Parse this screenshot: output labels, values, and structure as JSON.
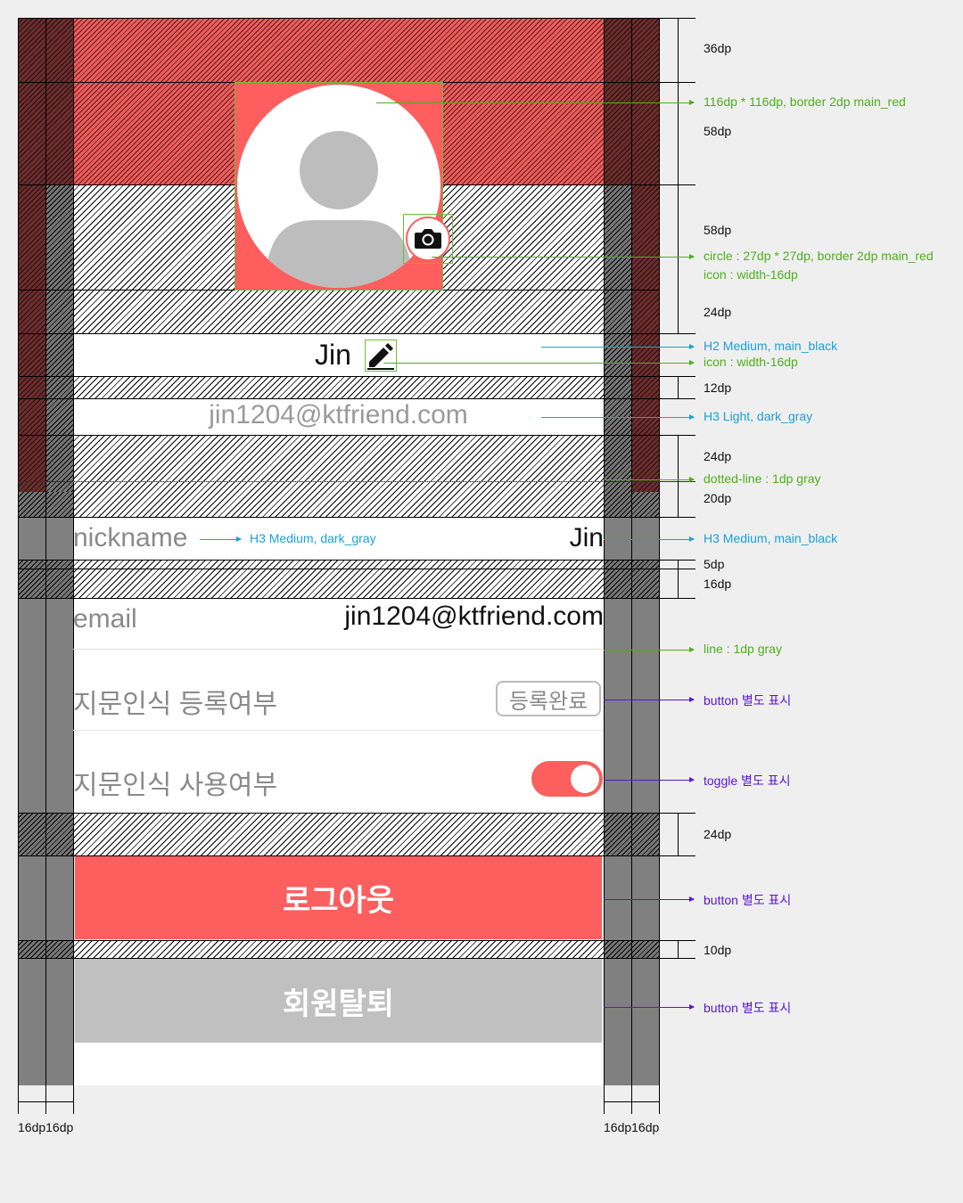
{
  "profile": {
    "name": "Jin",
    "email": "jin1204@ktfriend.com"
  },
  "rows": {
    "nickname_label": "nickname",
    "nickname_value": "Jin",
    "email_label": "email",
    "email_value": "jin1204@ktfriend.com",
    "fingerprint_register_label": "지문인식 등록여부",
    "fingerprint_register_button": "등록완료",
    "fingerprint_use_label": "지문인식 사용여부"
  },
  "buttons": {
    "logout": "로그아웃",
    "withdraw": "회원탈퇴"
  },
  "toggle": {
    "on": true
  },
  "dimensions": {
    "d36": "36dp",
    "d58a": "58dp",
    "d58b": "58dp",
    "d24a": "24dp",
    "d12": "12dp",
    "d24b": "24dp",
    "d20": "20dp",
    "d5": "5dp",
    "d16": "16dp",
    "d24c": "24dp",
    "d10": "10dp",
    "bottom_left": "16dp16dp",
    "bottom_right": "16dp16dp"
  },
  "annotations": {
    "avatar_spec": "116dp * 116dp, border 2dp main_red",
    "camera_circle": "circle : 27dp * 27dp, border 2dp main_red",
    "camera_icon": "icon : width-16dp",
    "name_style": "H2 Medium, main_black",
    "edit_icon": "icon : width-16dp",
    "email_style": "H3 Light, dark_gray",
    "dotted_line": "dotted-line : 1dp gray",
    "nickname_label_style": "H3 Medium, dark_gray",
    "nickname_value_style": "H3 Medium, main_black",
    "line": "line : 1dp gray",
    "button_note_1": "button 별도 표시",
    "toggle_note": "toggle 별도 표시",
    "button_note_2": "button 별도 표시",
    "button_note_3": "button 별도 표시"
  },
  "colors": {
    "main_red": "#fd5e5e",
    "main_black": "#111111",
    "dark_gray": "#8a8a8a",
    "gray_button": "#c0c0c0",
    "annotation_green": "#4caf1a",
    "annotation_blue": "#1aa0d8",
    "annotation_purple": "#5a14d6"
  },
  "icons": [
    "person-silhouette-icon",
    "camera-icon",
    "pencil-edit-icon"
  ]
}
